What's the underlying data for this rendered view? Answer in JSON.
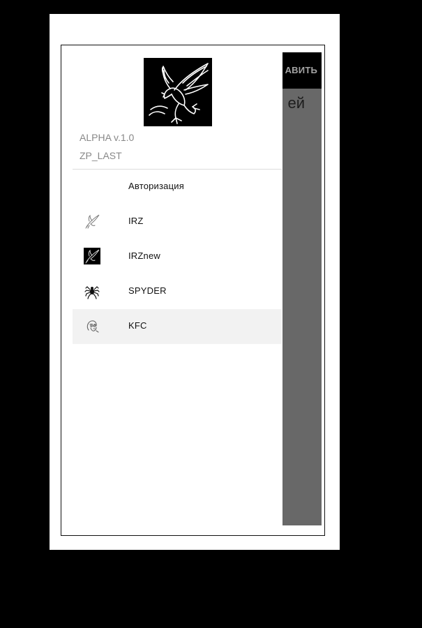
{
  "header": {
    "version": "ALPHA v.1.0",
    "config_name": "ZP_LAST",
    "logo_icon": "eagle-logo-icon"
  },
  "menu": {
    "items": [
      {
        "label": "Авторизация",
        "icon": "none",
        "selected": false
      },
      {
        "label": "IRZ",
        "icon": "eagle-outline-icon",
        "selected": false
      },
      {
        "label": "IRZnew",
        "icon": "eagle-dark-icon",
        "selected": false
      },
      {
        "label": "SPYDER",
        "icon": "spider-icon",
        "selected": false
      },
      {
        "label": "KFC",
        "icon": "colonel-head-icon",
        "selected": true
      }
    ]
  },
  "background_app": {
    "toolbar_button": "АВИТЬ",
    "content_text": "ей"
  },
  "colors": {
    "drawer_bg": "#ffffff",
    "selected_item_bg": "#f2f2f2",
    "toolbar_bg": "#000000",
    "content_bg": "#777777",
    "secondary_text": "#888888"
  }
}
